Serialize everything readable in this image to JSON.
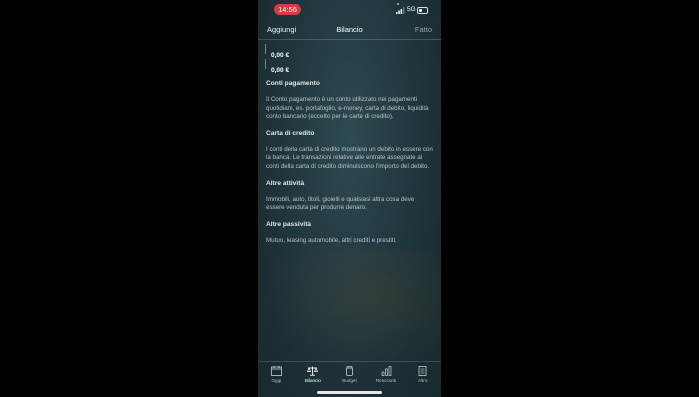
{
  "status_bar": {
    "time": "14:56",
    "network": "5G"
  },
  "nav": {
    "left": "Aggiungi",
    "title": "Bilancio",
    "right": "Fatto"
  },
  "amounts": [
    "0,00 €",
    "0,00 €"
  ],
  "sections": [
    {
      "title": "Conti pagamento",
      "text": "Il Conto pagamento è un conto utilizzato nei pagamenti quotidiani, es. portafoglio, e-money, carta di debito, liquidità conto bancario (eccetto per le carte di credito)."
    },
    {
      "title": "Carta di credito",
      "text": "I conti della carta di credito mostrano un debito in essere con la banca. Le transazioni relative alle entrate assegnate ai conti della carta di credito diminuiscono l'importo del debito."
    },
    {
      "title": "Altre attività",
      "text": "Immobili, auto, titoli, gioielli e qualsiasi altra cosa deve essere venduta per produrre denaro."
    },
    {
      "title": "Altre passività",
      "text": "Mutuo, leasing automobile, altri crediti e prestiti."
    }
  ],
  "tabs": [
    {
      "label": "Oggi",
      "icon": "calendar-icon"
    },
    {
      "label": "Bilancio",
      "icon": "scale-icon"
    },
    {
      "label": "Budget",
      "icon": "jar-icon"
    },
    {
      "label": "Resoconti",
      "icon": "bar-chart-icon"
    },
    {
      "label": "Altro",
      "icon": "document-icon"
    }
  ]
}
